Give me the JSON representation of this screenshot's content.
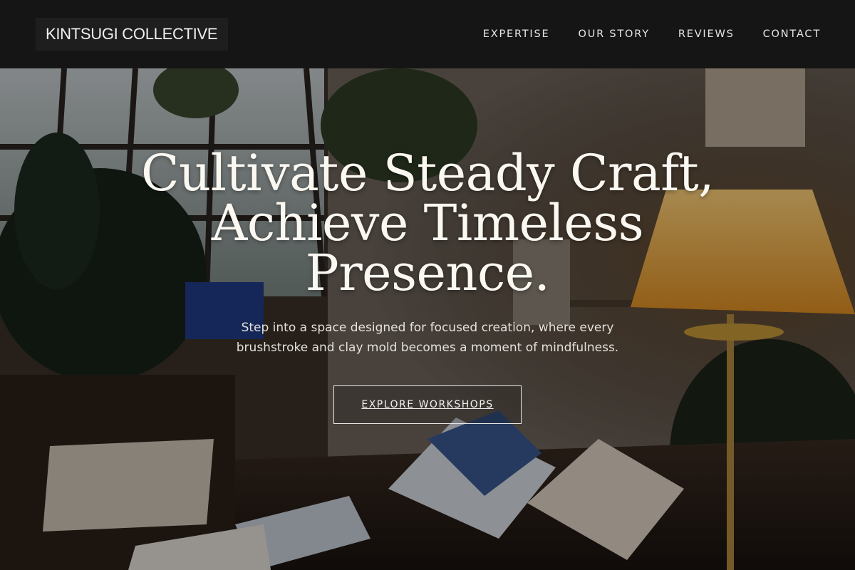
{
  "brand": {
    "name": "KINTSUGI COLLECTIVE"
  },
  "nav": {
    "items": [
      {
        "label": "EXPERTISE"
      },
      {
        "label": "OUR STORY"
      },
      {
        "label": "REVIEWS"
      },
      {
        "label": "CONTACT"
      }
    ]
  },
  "hero": {
    "title_lines": [
      "Cultivate Steady Craft,",
      "Achieve Timeless",
      "Presence."
    ],
    "subtitle": "Step into a space designed for focused creation, where every brushstroke and clay mold becomes a moment of mindfulness.",
    "cta_label": "EXPLORE WORKSHOPS",
    "background": "dim-art-studio-photo"
  },
  "colors": {
    "nav_bg": "#151515",
    "logo_bg": "#1e1e1e",
    "text_light": "#fbf8f2",
    "lamp_glow": "#f2b24a"
  }
}
